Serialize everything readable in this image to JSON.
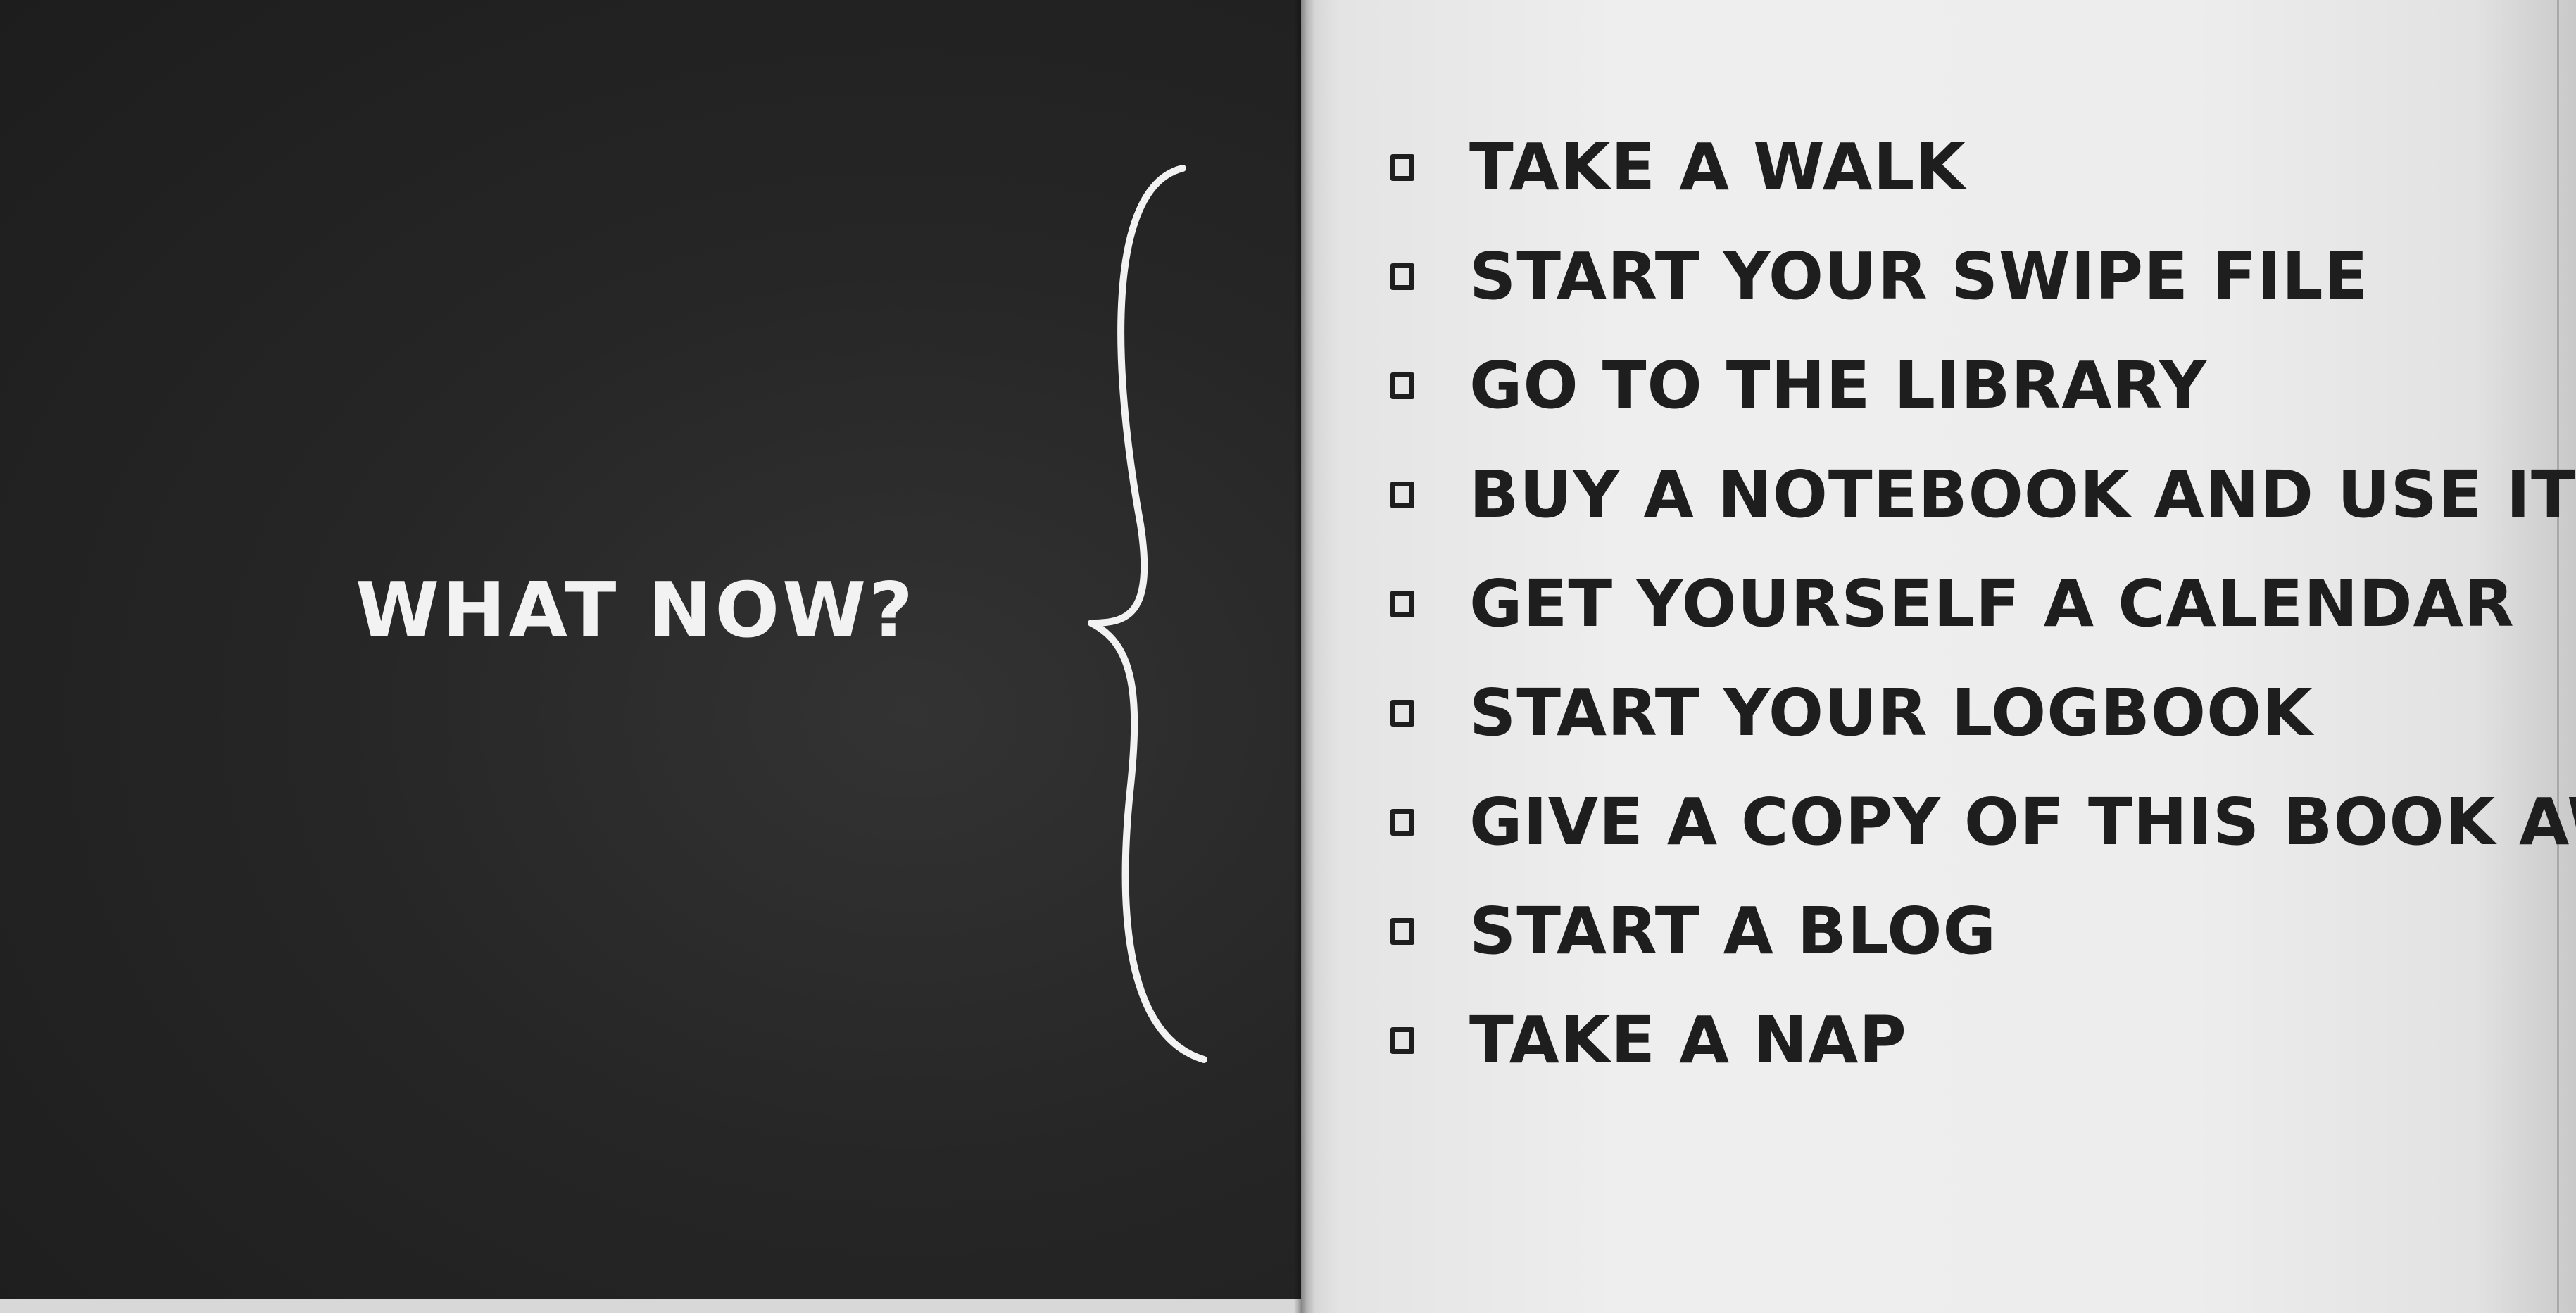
{
  "left_page": {
    "heading": "WHAT NOW?"
  },
  "checklist": {
    "items": [
      {
        "label": "TAKE A WALK",
        "checked": false
      },
      {
        "label": "START YOUR SWIPE FILE",
        "checked": false
      },
      {
        "label": "GO TO THE LIBRARY",
        "checked": false
      },
      {
        "label": "BUY A NOTEBOOK AND USE IT",
        "checked": false
      },
      {
        "label": "GET YOURSELF A CALENDAR",
        "checked": false
      },
      {
        "label": "START YOUR LOGBOOK",
        "checked": false
      },
      {
        "label": "GIVE A COPY OF THIS BOOK AWAY",
        "checked": false
      },
      {
        "label": "START A BLOG",
        "checked": false
      },
      {
        "label": "TAKE A NAP",
        "checked": false
      }
    ]
  },
  "colors": {
    "left_page_bg": "#262626",
    "right_page_bg": "#ededed",
    "chalk_text": "#f2f2f2",
    "ink_text": "#1e1e1e"
  },
  "icons": {
    "brace": "curly-brace-icon",
    "checkbox": "empty-checkbox-icon"
  }
}
